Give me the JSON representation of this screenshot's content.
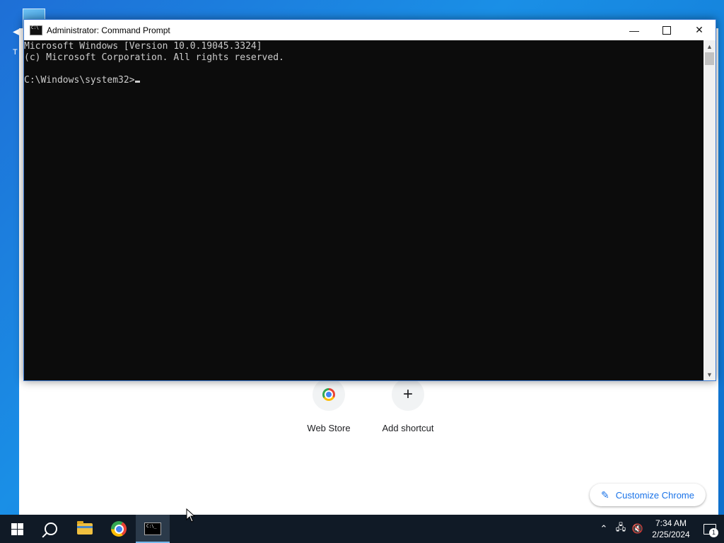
{
  "desktop": {
    "icon_label": "T"
  },
  "chrome": {
    "shortcuts": [
      {
        "label": "Web Store"
      },
      {
        "label": "Add shortcut"
      }
    ],
    "customize_label": "Customize Chrome"
  },
  "cmd": {
    "title": "Administrator: Command Prompt",
    "lines": [
      "Microsoft Windows [Version 10.0.19045.3324]",
      "(c) Microsoft Corporation. All rights reserved.",
      "",
      "C:\\Windows\\system32>"
    ]
  },
  "taskbar": {
    "time": "7:34 AM",
    "date": "2/25/2024",
    "notification_count": "1",
    "items": [
      "start",
      "search",
      "file-explorer",
      "chrome",
      "command-prompt"
    ]
  }
}
